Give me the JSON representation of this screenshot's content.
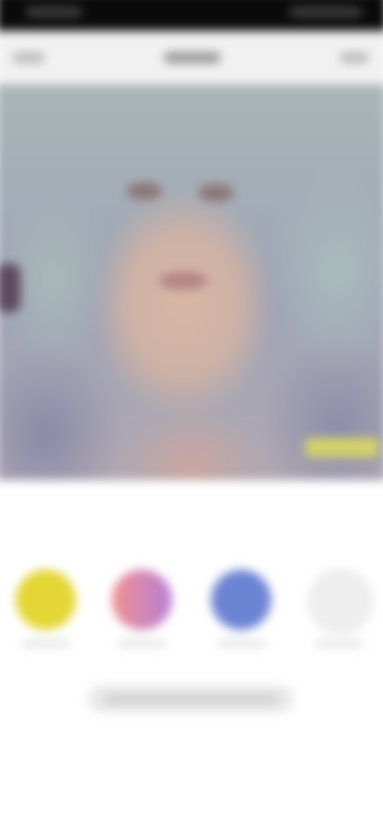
{
  "status_bar": {},
  "header": {},
  "photo": {},
  "options": [
    {
      "color": "#e3d634",
      "name": "yellow"
    },
    {
      "color": "#c987c0",
      "name": "pink"
    },
    {
      "color": "#6c84d4",
      "name": "blue"
    },
    {
      "color": "#eeeeee",
      "name": "gray"
    }
  ],
  "action": {}
}
